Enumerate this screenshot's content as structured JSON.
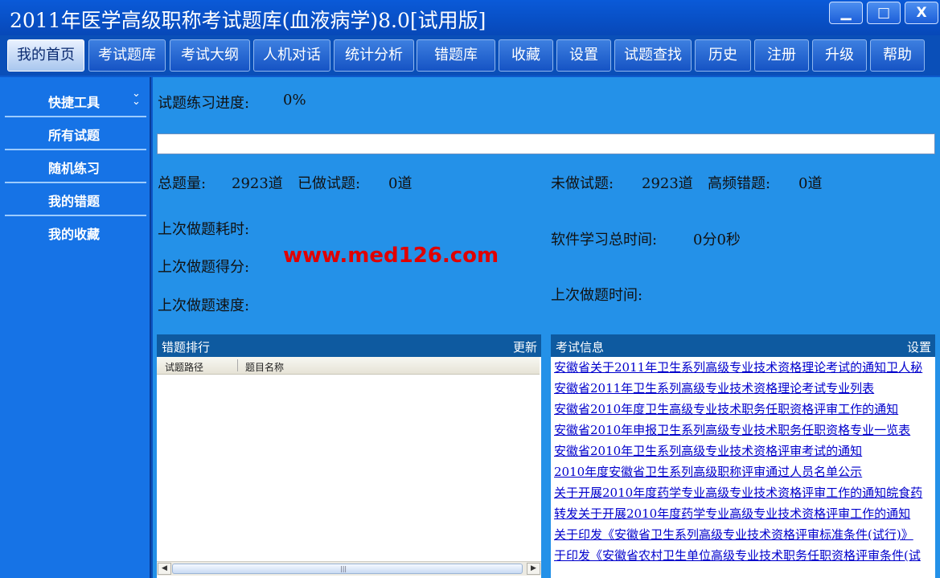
{
  "window": {
    "title": "2011年医学高级职称考试题库(血液病学)8.0[试用版]",
    "min_label": "▁",
    "max_label": "□",
    "close_label": "X"
  },
  "menu": [
    {
      "label": "我的首页",
      "active": true
    },
    {
      "label": "考试题库"
    },
    {
      "label": "考试大纲"
    },
    {
      "label": "人机对话"
    },
    {
      "label": "统计分析"
    },
    {
      "label": "错题库"
    },
    {
      "label": "收藏"
    },
    {
      "label": "设置"
    },
    {
      "label": "试题查找"
    },
    {
      "label": "历史"
    },
    {
      "label": "注册"
    },
    {
      "label": "升级"
    },
    {
      "label": "帮助"
    }
  ],
  "sidebar": {
    "header": "快捷工具",
    "items": [
      {
        "label": "所有试题"
      },
      {
        "label": "随机练习"
      },
      {
        "label": "我的错题"
      },
      {
        "label": "我的收藏"
      }
    ]
  },
  "stats": {
    "progress_label": "试题练习进度:",
    "progress_value": "0%",
    "progress_fraction": 0,
    "total_label": "总题量:",
    "total_value": "2923道",
    "done_label": "已做试题:",
    "done_value": "0道",
    "undone_label": "未做试题:",
    "undone_value": "2923道",
    "frequent_wrong_label": "高频错题:",
    "frequent_wrong_value": "0道",
    "last_time_spent_label": "上次做题耗时:",
    "last_score_label": "上次做题得分:",
    "last_speed_label": "上次做题速度:",
    "total_study_time_label": "软件学习总时间:",
    "total_study_time_value": "0分0秒",
    "last_time_label": "上次做题时间:"
  },
  "watermark": "www.med126.com",
  "wrong_ranking": {
    "title": "错题排行",
    "action": "更新",
    "columns": [
      "试题路径",
      "题目名称"
    ],
    "rows": [],
    "scroll_grip": "|||"
  },
  "exam_info": {
    "title": "考试信息",
    "action": "设置",
    "items": [
      "安徽省关于2011年卫生系列高级专业技术资格理论考试的通知卫人秘",
      "安徽省2011年卫生系列高级专业技术资格理论考试专业列表",
      "安徽省2010年度卫生高级专业技术职务任职资格评审工作的通知",
      "安徽省2010年申报卫生系列高级专业技术职务任职资格专业一览表",
      "安徽省2010年卫生系列高级专业技术资格评审考试的通知",
      "2010年度安徽省卫生系列高级职称评审通过人员名单公示",
      "关于开展2010年度药学专业高级专业技术资格评审工作的通知皖食药",
      "转发关于开展2010年度药学专业高级专业技术资格评审工作的通知",
      "关于印发《安徽省卫生系列高级专业技术资格评审标准条件(试行)》",
      "于印发《安徽省农村卫生单位高级专业技术职务任职资格评审条件(试"
    ]
  }
}
